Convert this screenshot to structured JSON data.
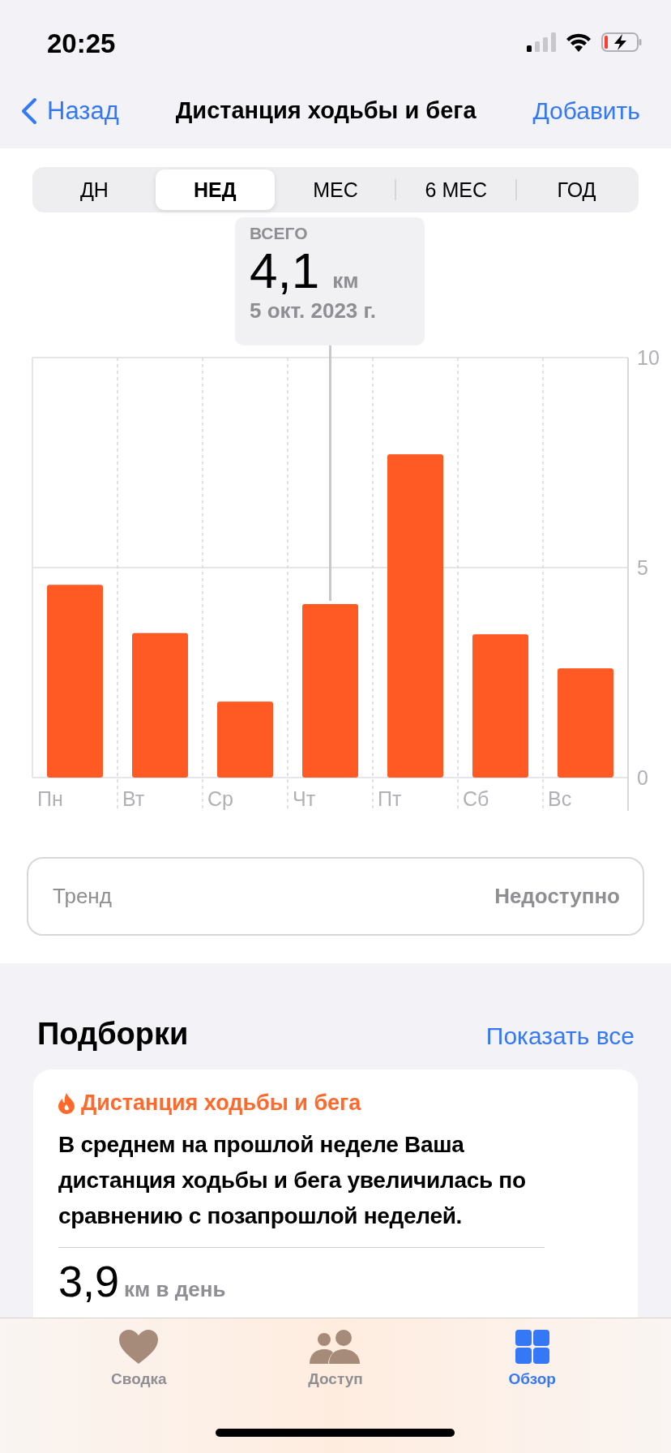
{
  "status_bar": {
    "time": "20:25"
  },
  "nav": {
    "back": "Назад",
    "title": "Дистанция ходьбы и бега",
    "action": "Добавить"
  },
  "segments": [
    {
      "label": "ДН",
      "selected": false
    },
    {
      "label": "НЕД",
      "selected": true
    },
    {
      "label": "МЕС",
      "selected": false
    },
    {
      "label": "6 МЕС",
      "selected": false
    },
    {
      "label": "ГОД",
      "selected": false
    }
  ],
  "tooltip": {
    "label": "ВСЕГО",
    "value": "4,1",
    "unit": "км",
    "date": "5 окт. 2023 г."
  },
  "chart_data": {
    "type": "bar",
    "categories": [
      "Пн",
      "Вт",
      "Ср",
      "Чт",
      "Пт",
      "Сб",
      "Вс"
    ],
    "values": [
      4.59,
      3.44,
      1.81,
      4.13,
      7.7,
      3.41,
      2.6
    ],
    "ylim": [
      0,
      10
    ],
    "yticks": [
      0,
      5,
      10
    ]
  },
  "trend": {
    "label": "Тренд",
    "value": "Недоступно"
  },
  "highlights": {
    "title": "Подборки",
    "show_all": "Показать все",
    "card": {
      "category": "Дистанция ходьбы и бега",
      "text": "В среднем на прошлой неделе Ваша дистанция ходьбы и бега увеличилась по сравнению с позапрошлой неделей.",
      "value": "3,9",
      "unit": "км в день"
    }
  },
  "tab_bar": [
    {
      "label": "Сводка",
      "kind": "heart",
      "selected": false
    },
    {
      "label": "Доступ",
      "kind": "people",
      "selected": false
    },
    {
      "label": "Обзор",
      "kind": "grid",
      "selected": true
    }
  ]
}
